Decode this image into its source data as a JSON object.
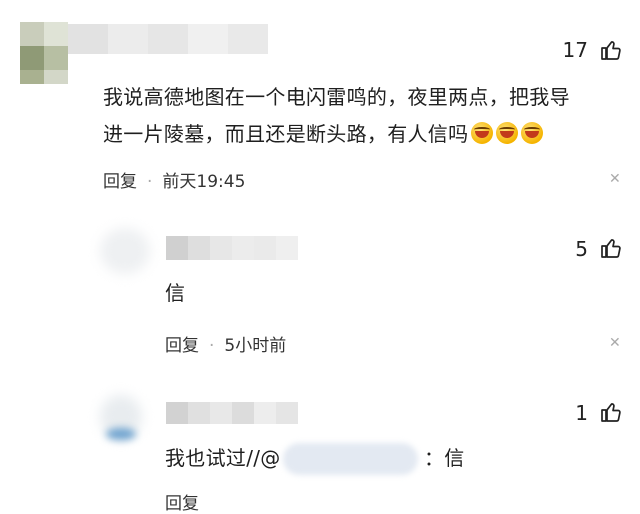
{
  "comments": [
    {
      "likes": "17",
      "text_line1": "我说高德地图在一个电闪雷鸣的，夜里两点，把我导",
      "text_line2": "进一片陵墓，而且还是断头路，有人信吗",
      "reply_label": "回复",
      "time": "前天19:45"
    },
    {
      "likes": "5",
      "text": "信",
      "reply_label": "回复",
      "time": "5小时前"
    },
    {
      "likes": "1",
      "text_prefix": "我也试过//@",
      "text_suffix": "：信",
      "reply_label": "回复"
    }
  ],
  "icons": {
    "like": "thumbs-up-icon",
    "close": "close-icon",
    "emoji": "laughing-crying-emoji-icon"
  }
}
